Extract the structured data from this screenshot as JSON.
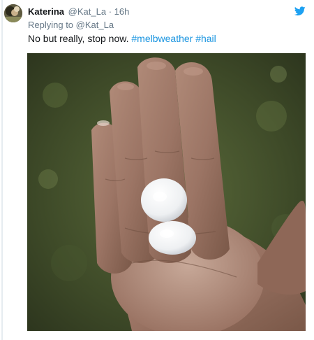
{
  "tweet": {
    "display_name": "Katerina",
    "handle": "@Kat_La",
    "separator": "·",
    "time": "16h",
    "reply_prefix": "Replying to",
    "reply_mention": "@Kat_La",
    "text_plain": "No but really, stop now. ",
    "hashtags": [
      "#melbweather",
      "#hail"
    ],
    "icons": {
      "network": "twitter-bird-icon"
    },
    "colors": {
      "link": "#1b95e0",
      "secondary": "#657786",
      "bird": "#1da1f2"
    }
  }
}
